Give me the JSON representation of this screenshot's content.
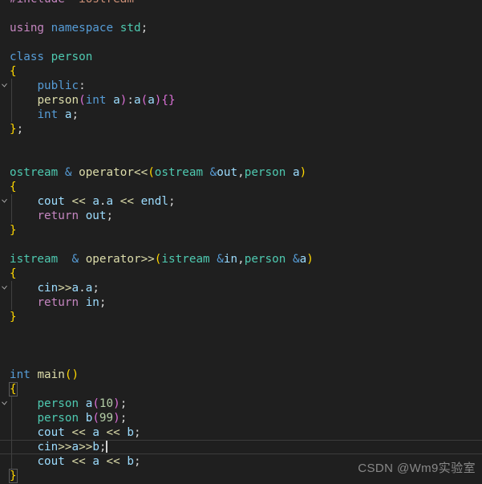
{
  "editor": {
    "language": "cpp",
    "background_color": "#1f1f1f",
    "current_line_index": 23,
    "theme": "dark-plus"
  },
  "watermark": {
    "text": "CSDN @Wm9实验室"
  },
  "code": {
    "raw": "#include \"iostream\"\n\nusing namespace std;\n\nclass person\n{\n    public:\n    person(int a):a(a){}\n    int a;\n};\n\n\nostream & operator<<(ostream &out,person a)\n{\n    cout << a.a << endl;\n    return out;\n}\n\nistream  & operator>>(istream &in,person &a)\n{\n    cin>>a.a;\n    return in;\n}\n\n\n\nint main()\n{\n    person a(10);\n    person b(99);\n    cout << a << b;\n    cin>>a>>b;\n    cout << a << b;\n}",
    "lines": [
      {
        "n": 1,
        "text": "#include \"iostream\"",
        "fold": false
      },
      {
        "n": 2,
        "text": "",
        "fold": false
      },
      {
        "n": 3,
        "text": "using namespace std;",
        "fold": false
      },
      {
        "n": 4,
        "text": "",
        "fold": false
      },
      {
        "n": 5,
        "text": "class person",
        "fold": true
      },
      {
        "n": 6,
        "text": "{",
        "fold": false
      },
      {
        "n": 7,
        "text": "    public:",
        "fold": false
      },
      {
        "n": 8,
        "text": "    person(int a):a(a){}",
        "fold": false
      },
      {
        "n": 9,
        "text": "    int a;",
        "fold": false
      },
      {
        "n": 10,
        "text": "};",
        "fold": false
      },
      {
        "n": 11,
        "text": "",
        "fold": false
      },
      {
        "n": 12,
        "text": "",
        "fold": false
      },
      {
        "n": 13,
        "text": "ostream & operator<<(ostream &out,person a)",
        "fold": true
      },
      {
        "n": 14,
        "text": "{",
        "fold": false
      },
      {
        "n": 15,
        "text": "    cout << a.a << endl;",
        "fold": false
      },
      {
        "n": 16,
        "text": "    return out;",
        "fold": false
      },
      {
        "n": 17,
        "text": "}",
        "fold": false
      },
      {
        "n": 18,
        "text": "",
        "fold": false
      },
      {
        "n": 19,
        "text": "istream  & operator>>(istream &in,person &a)",
        "fold": true
      },
      {
        "n": 20,
        "text": "{",
        "fold": false
      },
      {
        "n": 21,
        "text": "    cin>>a.a;",
        "fold": false
      },
      {
        "n": 22,
        "text": "    return in;",
        "fold": false
      },
      {
        "n": 23,
        "text": "}",
        "fold": false
      },
      {
        "n": 24,
        "text": "",
        "fold": false
      },
      {
        "n": 25,
        "text": "",
        "fold": false
      },
      {
        "n": 26,
        "text": "",
        "fold": false
      },
      {
        "n": 27,
        "text": "int main()",
        "fold": true
      },
      {
        "n": 28,
        "text": "{",
        "fold": false
      },
      {
        "n": 29,
        "text": "    person a(10);",
        "fold": false
      },
      {
        "n": 30,
        "text": "    person b(99);",
        "fold": false
      },
      {
        "n": 31,
        "text": "    cout << a << b;",
        "fold": false
      },
      {
        "n": 32,
        "text": "    cin>>a>>b;",
        "fold": false
      },
      {
        "n": 33,
        "text": "    cout << a << b;",
        "fold": false
      },
      {
        "n": 34,
        "text": "}",
        "fold": false
      }
    ]
  },
  "colors": {
    "background": "#1f1f1f",
    "foreground": "#d4d4d4",
    "keyword": "#c586c0",
    "keyword_control": "#569cd6",
    "type": "#4ec9b0",
    "function": "#dcdcaa",
    "variable": "#9cdcfe",
    "number": "#b5cea8",
    "string": "#ce9178",
    "bracket_yellow": "#ffd700",
    "bracket_pink": "#da70d6",
    "bracket_blue": "#179fff",
    "indent_guide": "#404040",
    "current_line_border": "#3c3c3c",
    "cursor": "#d4d4d4",
    "watermark": "#9b9b9b"
  }
}
